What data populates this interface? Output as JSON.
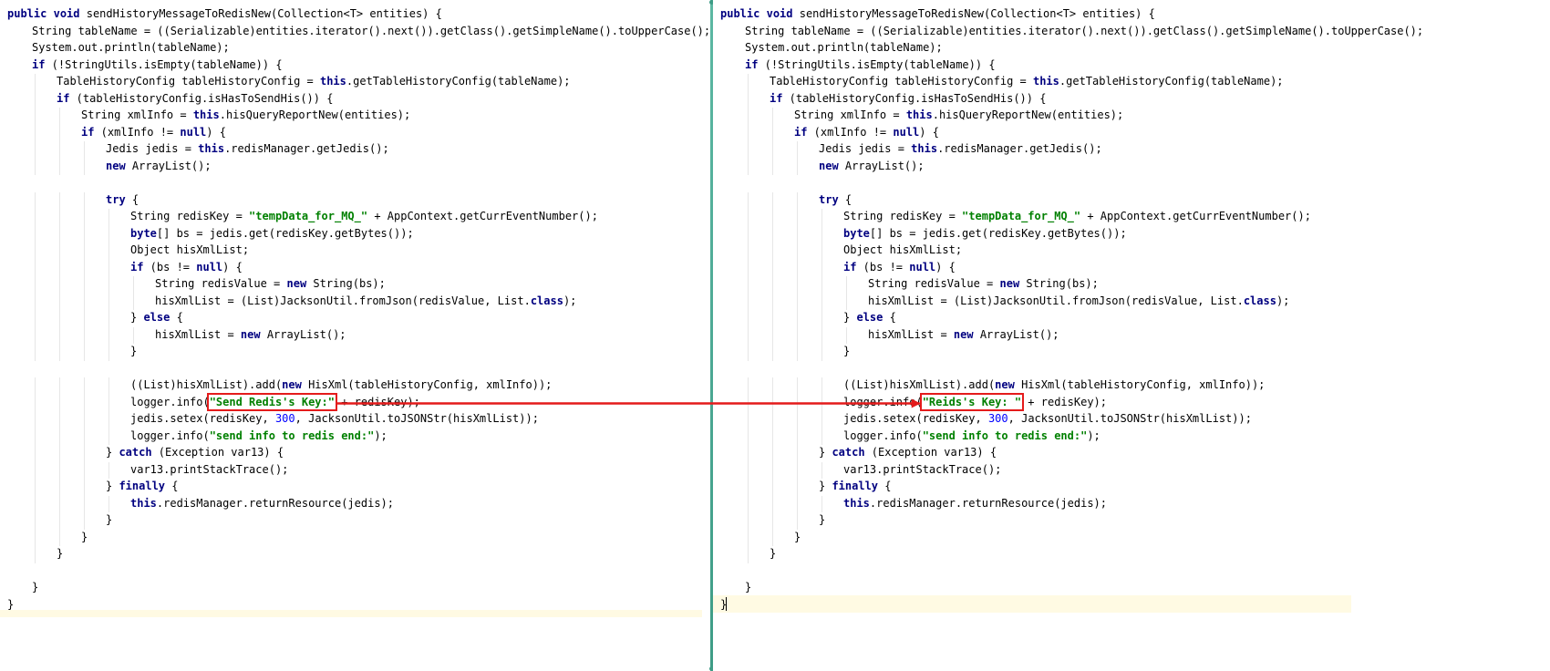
{
  "left_pane": {
    "lines": [
      {
        "indent": 0,
        "tokens": [
          {
            "t": "kw",
            "v": "public"
          },
          {
            "t": "p",
            "v": " "
          },
          {
            "t": "kw",
            "v": "void"
          },
          {
            "t": "p",
            "v": " sendHistoryMessageToRedisNew(Collection<T> entities) {"
          }
        ]
      },
      {
        "indent": 1,
        "tokens": [
          {
            "t": "p",
            "v": "String tableName = ((Serializable)entities.iterator().next()).getClass().getSimpleName().toUpperCase();"
          }
        ]
      },
      {
        "indent": 1,
        "tokens": [
          {
            "t": "p",
            "v": "System.out.println(tableName);"
          }
        ]
      },
      {
        "indent": 1,
        "tokens": [
          {
            "t": "kw",
            "v": "if"
          },
          {
            "t": "p",
            "v": " (!StringUtils.isEmpty(tableName)) {"
          }
        ]
      },
      {
        "indent": 2,
        "tokens": [
          {
            "t": "p",
            "v": "TableHistoryConfig tableHistoryConfig = "
          },
          {
            "t": "kw",
            "v": "this"
          },
          {
            "t": "p",
            "v": ".getTableHistoryConfig(tableName);"
          }
        ]
      },
      {
        "indent": 2,
        "tokens": [
          {
            "t": "kw",
            "v": "if"
          },
          {
            "t": "p",
            "v": " (tableHistoryConfig.isHasToSendHis()) {"
          }
        ]
      },
      {
        "indent": 3,
        "tokens": [
          {
            "t": "p",
            "v": "String xmlInfo = "
          },
          {
            "t": "kw",
            "v": "this"
          },
          {
            "t": "p",
            "v": ".hisQueryReportNew(entities);"
          }
        ]
      },
      {
        "indent": 3,
        "tokens": [
          {
            "t": "kw",
            "v": "if"
          },
          {
            "t": "p",
            "v": " (xmlInfo != "
          },
          {
            "t": "kw",
            "v": "null"
          },
          {
            "t": "p",
            "v": ") {"
          }
        ]
      },
      {
        "indent": 4,
        "tokens": [
          {
            "t": "p",
            "v": "Jedis jedis = "
          },
          {
            "t": "kw",
            "v": "this"
          },
          {
            "t": "p",
            "v": ".redisManager.getJedis();"
          }
        ]
      },
      {
        "indent": 4,
        "tokens": [
          {
            "t": "kw",
            "v": "new"
          },
          {
            "t": "p",
            "v": " ArrayList();"
          }
        ]
      },
      {
        "indent": 0,
        "tokens": []
      },
      {
        "indent": 4,
        "tokens": [
          {
            "t": "kw",
            "v": "try"
          },
          {
            "t": "p",
            "v": " {"
          }
        ]
      },
      {
        "indent": 5,
        "tokens": [
          {
            "t": "p",
            "v": "String redisKey = "
          },
          {
            "t": "str",
            "v": "\"tempData_for_MQ_\""
          },
          {
            "t": "p",
            "v": " + AppContext.getCurrEventNumber();"
          }
        ]
      },
      {
        "indent": 5,
        "tokens": [
          {
            "t": "kw",
            "v": "byte"
          },
          {
            "t": "p",
            "v": "[] bs = jedis.get(redisKey.getBytes());"
          }
        ]
      },
      {
        "indent": 5,
        "tokens": [
          {
            "t": "p",
            "v": "Object hisXmlList;"
          }
        ]
      },
      {
        "indent": 5,
        "tokens": [
          {
            "t": "kw",
            "v": "if"
          },
          {
            "t": "p",
            "v": " (bs != "
          },
          {
            "t": "kw",
            "v": "null"
          },
          {
            "t": "p",
            "v": ") {"
          }
        ]
      },
      {
        "indent": 6,
        "tokens": [
          {
            "t": "p",
            "v": "String redisValue = "
          },
          {
            "t": "kw",
            "v": "new"
          },
          {
            "t": "p",
            "v": " String(bs);"
          }
        ]
      },
      {
        "indent": 6,
        "tokens": [
          {
            "t": "p",
            "v": "hisXmlList = (List)JacksonUtil.fromJson(redisValue, List."
          },
          {
            "t": "kw",
            "v": "class"
          },
          {
            "t": "p",
            "v": ");"
          }
        ]
      },
      {
        "indent": 5,
        "tokens": [
          {
            "t": "p",
            "v": "} "
          },
          {
            "t": "kw",
            "v": "else"
          },
          {
            "t": "p",
            "v": " {"
          }
        ]
      },
      {
        "indent": 6,
        "tokens": [
          {
            "t": "p",
            "v": "hisXmlList = "
          },
          {
            "t": "kw",
            "v": "new"
          },
          {
            "t": "p",
            "v": " ArrayList();"
          }
        ]
      },
      {
        "indent": 5,
        "tokens": [
          {
            "t": "p",
            "v": "}"
          }
        ]
      },
      {
        "indent": 0,
        "tokens": []
      },
      {
        "indent": 5,
        "tokens": [
          {
            "t": "p",
            "v": "((List)hisXmlList).add("
          },
          {
            "t": "kw",
            "v": "new"
          },
          {
            "t": "p",
            "v": " HisXml(tableHistoryConfig, xmlInfo));"
          }
        ]
      },
      {
        "indent": 5,
        "tokens": [
          {
            "t": "p",
            "v": "logger.info("
          },
          {
            "t": "str",
            "v": "\"Send Redis's Key:\""
          },
          {
            "t": "p",
            "v": " + redisKey);"
          }
        ]
      },
      {
        "indent": 5,
        "tokens": [
          {
            "t": "p",
            "v": "jedis.setex(redisKey, "
          },
          {
            "t": "num",
            "v": "300"
          },
          {
            "t": "p",
            "v": ", JacksonUtil.toJSONStr(hisXmlList));"
          }
        ]
      },
      {
        "indent": 5,
        "tokens": [
          {
            "t": "p",
            "v": "logger.info("
          },
          {
            "t": "str",
            "v": "\"send info to redis end:\""
          },
          {
            "t": "p",
            "v": ");"
          }
        ]
      },
      {
        "indent": 4,
        "tokens": [
          {
            "t": "p",
            "v": "} "
          },
          {
            "t": "kw",
            "v": "catch"
          },
          {
            "t": "p",
            "v": " (Exception var13) {"
          }
        ]
      },
      {
        "indent": 5,
        "tokens": [
          {
            "t": "p",
            "v": "var13.printStackTrace();"
          }
        ]
      },
      {
        "indent": 4,
        "tokens": [
          {
            "t": "p",
            "v": "} "
          },
          {
            "t": "kw",
            "v": "finally"
          },
          {
            "t": "p",
            "v": " {"
          }
        ]
      },
      {
        "indent": 5,
        "tokens": [
          {
            "t": "kw",
            "v": "this"
          },
          {
            "t": "p",
            "v": ".redisManager.returnResource(jedis);"
          }
        ]
      },
      {
        "indent": 4,
        "tokens": [
          {
            "t": "p",
            "v": "}"
          }
        ]
      },
      {
        "indent": 3,
        "tokens": [
          {
            "t": "p",
            "v": "}"
          }
        ]
      },
      {
        "indent": 2,
        "tokens": [
          {
            "t": "p",
            "v": "}"
          }
        ]
      },
      {
        "indent": 0,
        "tokens": []
      },
      {
        "indent": 1,
        "tokens": [
          {
            "t": "p",
            "v": "}"
          }
        ]
      },
      {
        "indent": 0,
        "tokens": [
          {
            "t": "p",
            "v": "}"
          }
        ]
      }
    ]
  },
  "right_pane": {
    "lines": [
      {
        "indent": 0,
        "tokens": [
          {
            "t": "kw",
            "v": "public"
          },
          {
            "t": "p",
            "v": " "
          },
          {
            "t": "kw",
            "v": "void"
          },
          {
            "t": "p",
            "v": " sendHistoryMessageToRedisNew(Collection<T> entities) {"
          }
        ]
      },
      {
        "indent": 1,
        "tokens": [
          {
            "t": "p",
            "v": "String tableName = ((Serializable)entities.iterator().next()).getClass().getSimpleName().toUpperCase();"
          }
        ]
      },
      {
        "indent": 1,
        "tokens": [
          {
            "t": "p",
            "v": "System.out.println(tableName);"
          }
        ]
      },
      {
        "indent": 1,
        "tokens": [
          {
            "t": "kw",
            "v": "if"
          },
          {
            "t": "p",
            "v": " (!StringUtils.isEmpty(tableName)) {"
          }
        ]
      },
      {
        "indent": 2,
        "tokens": [
          {
            "t": "p",
            "v": "TableHistoryConfig tableHistoryConfig = "
          },
          {
            "t": "kw",
            "v": "this"
          },
          {
            "t": "p",
            "v": ".getTableHistoryConfig(tableName);"
          }
        ]
      },
      {
        "indent": 2,
        "tokens": [
          {
            "t": "kw",
            "v": "if"
          },
          {
            "t": "p",
            "v": " (tableHistoryConfig.isHasToSendHis()) {"
          }
        ]
      },
      {
        "indent": 3,
        "tokens": [
          {
            "t": "p",
            "v": "String xmlInfo = "
          },
          {
            "t": "kw",
            "v": "this"
          },
          {
            "t": "p",
            "v": ".hisQueryReportNew(entities);"
          }
        ]
      },
      {
        "indent": 3,
        "tokens": [
          {
            "t": "kw",
            "v": "if"
          },
          {
            "t": "p",
            "v": " (xmlInfo != "
          },
          {
            "t": "kw",
            "v": "null"
          },
          {
            "t": "p",
            "v": ") {"
          }
        ]
      },
      {
        "indent": 4,
        "tokens": [
          {
            "t": "p",
            "v": "Jedis jedis = "
          },
          {
            "t": "kw",
            "v": "this"
          },
          {
            "t": "p",
            "v": ".redisManager.getJedis();"
          }
        ]
      },
      {
        "indent": 4,
        "tokens": [
          {
            "t": "kw",
            "v": "new"
          },
          {
            "t": "p",
            "v": " ArrayList();"
          }
        ]
      },
      {
        "indent": 0,
        "tokens": []
      },
      {
        "indent": 4,
        "tokens": [
          {
            "t": "kw",
            "v": "try"
          },
          {
            "t": "p",
            "v": " {"
          }
        ]
      },
      {
        "indent": 5,
        "tokens": [
          {
            "t": "p",
            "v": "String redisKey = "
          },
          {
            "t": "str",
            "v": "\"tempData_for_MQ_\""
          },
          {
            "t": "p",
            "v": " + AppContext.getCurrEventNumber();"
          }
        ]
      },
      {
        "indent": 5,
        "tokens": [
          {
            "t": "kw",
            "v": "byte"
          },
          {
            "t": "p",
            "v": "[] bs = jedis.get(redisKey.getBytes());"
          }
        ]
      },
      {
        "indent": 5,
        "tokens": [
          {
            "t": "p",
            "v": "Object hisXmlList;"
          }
        ]
      },
      {
        "indent": 5,
        "tokens": [
          {
            "t": "kw",
            "v": "if"
          },
          {
            "t": "p",
            "v": " (bs != "
          },
          {
            "t": "kw",
            "v": "null"
          },
          {
            "t": "p",
            "v": ") {"
          }
        ]
      },
      {
        "indent": 6,
        "tokens": [
          {
            "t": "p",
            "v": "String redisValue = "
          },
          {
            "t": "kw",
            "v": "new"
          },
          {
            "t": "p",
            "v": " String(bs);"
          }
        ]
      },
      {
        "indent": 6,
        "tokens": [
          {
            "t": "p",
            "v": "hisXmlList = (List)JacksonUtil.fromJson(redisValue, List."
          },
          {
            "t": "kw",
            "v": "class"
          },
          {
            "t": "p",
            "v": ");"
          }
        ]
      },
      {
        "indent": 5,
        "tokens": [
          {
            "t": "p",
            "v": "} "
          },
          {
            "t": "kw",
            "v": "else"
          },
          {
            "t": "p",
            "v": " {"
          }
        ]
      },
      {
        "indent": 6,
        "tokens": [
          {
            "t": "p",
            "v": "hisXmlList = "
          },
          {
            "t": "kw",
            "v": "new"
          },
          {
            "t": "p",
            "v": " ArrayList();"
          }
        ]
      },
      {
        "indent": 5,
        "tokens": [
          {
            "t": "p",
            "v": "}"
          }
        ]
      },
      {
        "indent": 0,
        "tokens": []
      },
      {
        "indent": 5,
        "tokens": [
          {
            "t": "p",
            "v": "((List)hisXmlList).add("
          },
          {
            "t": "kw",
            "v": "new"
          },
          {
            "t": "p",
            "v": " HisXml(tableHistoryConfig, xmlInfo));"
          }
        ]
      },
      {
        "indent": 5,
        "tokens": [
          {
            "t": "p",
            "v": "logger.info("
          },
          {
            "t": "str",
            "v": "\"Reids's Key: \""
          },
          {
            "t": "p",
            "v": " + redisKey);"
          }
        ]
      },
      {
        "indent": 5,
        "tokens": [
          {
            "t": "p",
            "v": "jedis.setex(redisKey, "
          },
          {
            "t": "num",
            "v": "300"
          },
          {
            "t": "p",
            "v": ", JacksonUtil.toJSONStr(hisXmlList));"
          }
        ]
      },
      {
        "indent": 5,
        "tokens": [
          {
            "t": "p",
            "v": "logger.info("
          },
          {
            "t": "str",
            "v": "\"send info to redis end:\""
          },
          {
            "t": "p",
            "v": ");"
          }
        ]
      },
      {
        "indent": 4,
        "tokens": [
          {
            "t": "p",
            "v": "} "
          },
          {
            "t": "kw",
            "v": "catch"
          },
          {
            "t": "p",
            "v": " (Exception var13) {"
          }
        ]
      },
      {
        "indent": 5,
        "tokens": [
          {
            "t": "p",
            "v": "var13.printStackTrace();"
          }
        ]
      },
      {
        "indent": 4,
        "tokens": [
          {
            "t": "p",
            "v": "} "
          },
          {
            "t": "kw",
            "v": "finally"
          },
          {
            "t": "p",
            "v": " {"
          }
        ]
      },
      {
        "indent": 5,
        "tokens": [
          {
            "t": "kw",
            "v": "this"
          },
          {
            "t": "p",
            "v": ".redisManager.returnResource(jedis);"
          }
        ]
      },
      {
        "indent": 4,
        "tokens": [
          {
            "t": "p",
            "v": "}"
          }
        ]
      },
      {
        "indent": 3,
        "tokens": [
          {
            "t": "p",
            "v": "}"
          }
        ]
      },
      {
        "indent": 2,
        "tokens": [
          {
            "t": "p",
            "v": "}"
          }
        ]
      },
      {
        "indent": 0,
        "tokens": []
      },
      {
        "indent": 1,
        "tokens": [
          {
            "t": "p",
            "v": "}"
          }
        ]
      },
      {
        "indent": 0,
        "tokens": [
          {
            "t": "p",
            "v": "}"
          }
        ]
      }
    ]
  },
  "colors": {
    "keyword": "#000080",
    "string": "#008000",
    "number": "#0000ff",
    "annotation": "#e41b1b",
    "divider": "#3e9c86",
    "current_line": "#fffae3"
  }
}
